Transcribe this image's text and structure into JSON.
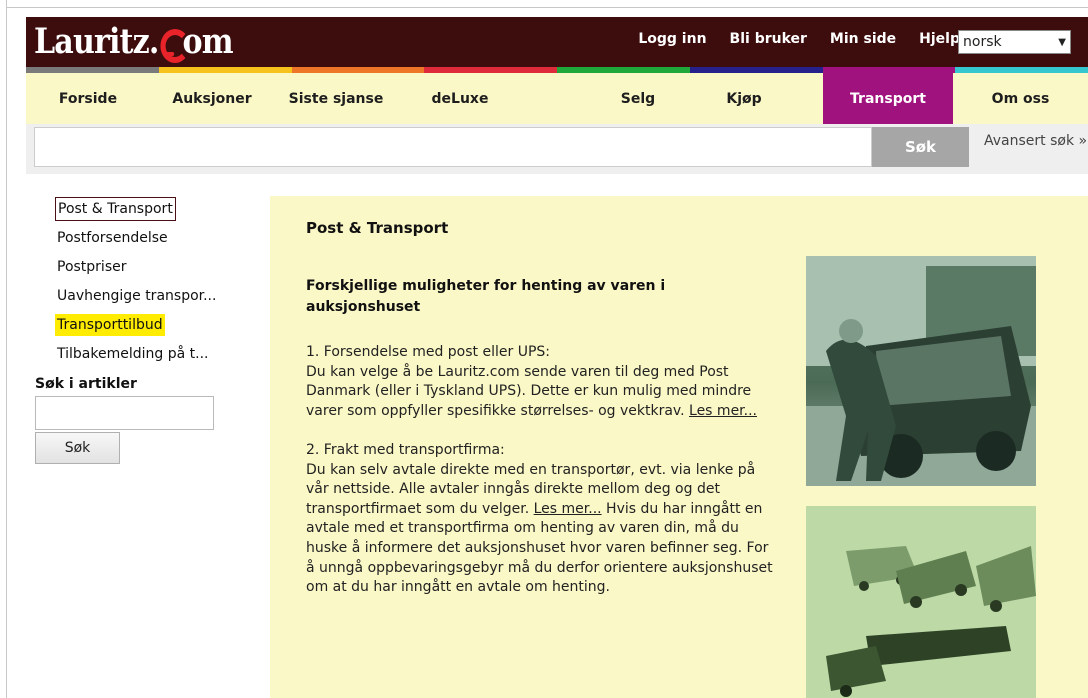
{
  "header": {
    "logo_left": "Lauritz.",
    "logo_right": "om",
    "links": [
      "Logg inn",
      "Bli bruker",
      "Min side",
      "Hjelp"
    ],
    "language": "norsk"
  },
  "strip_colors": [
    "#7a7a7a",
    "#f8c21c",
    "#ee7628",
    "#de2a3a",
    "#21a83b",
    "#26208a",
    "#a0127d",
    "#36c8d0"
  ],
  "nav": {
    "items": [
      "Forside",
      "Auksjoner",
      "Siste sjanse",
      "deLuxe",
      "Selg",
      "Kjøp",
      "Transport",
      "Om oss"
    ],
    "active_index": 6,
    "active_color": "#a0127d"
  },
  "search": {
    "value": "",
    "button": "Søk",
    "advanced": "Avansert søk »"
  },
  "sidebar": {
    "items": [
      {
        "label": "Post & Transport",
        "style": "outlined"
      },
      {
        "label": "Postforsendelse",
        "style": ""
      },
      {
        "label": "Postpriser",
        "style": ""
      },
      {
        "label": "Uavhengige transpor...",
        "style": ""
      },
      {
        "label": "Transporttilbud",
        "style": "highlighted"
      },
      {
        "label": "Tilbakemelding på t...",
        "style": ""
      }
    ],
    "article_search_title": "Søk i artikler",
    "article_search_button": "Søk"
  },
  "content": {
    "title": "Post & Transport",
    "subtitle": "Forskjellige muligheter for henting av varen i auksjonshuset",
    "p1_heading": "1. Forsendelse med post eller UPS:",
    "p1_text": "Du kan velge å be Lauritz.com sende varen til deg med Post Danmark (eller i Tyskland UPS). Dette er kun mulig med mindre varer som oppfyller spesifikke størrelses- og vektkrav.",
    "p1_link": "Les mer...",
    "p2_heading": "2. Frakt med transportfirma:",
    "p2_text": "Du kan selv avtale direkte med en transportør, evt. via lenke på vår nettside. Alle avtaler inngås direkte mellom deg og det transportfirmaet som du velger.",
    "p2_link": "Les mer...",
    "p2_text_after": "Hvis du har inngått en avtale med et transportfirma om henting av varen din, må du huske å informere det auksjonshuset hvor varen befinner seg. For å unngå oppbevaringsgebyr må du derfor orientere auksjonshuset om at du har inngått en avtale om henting."
  }
}
